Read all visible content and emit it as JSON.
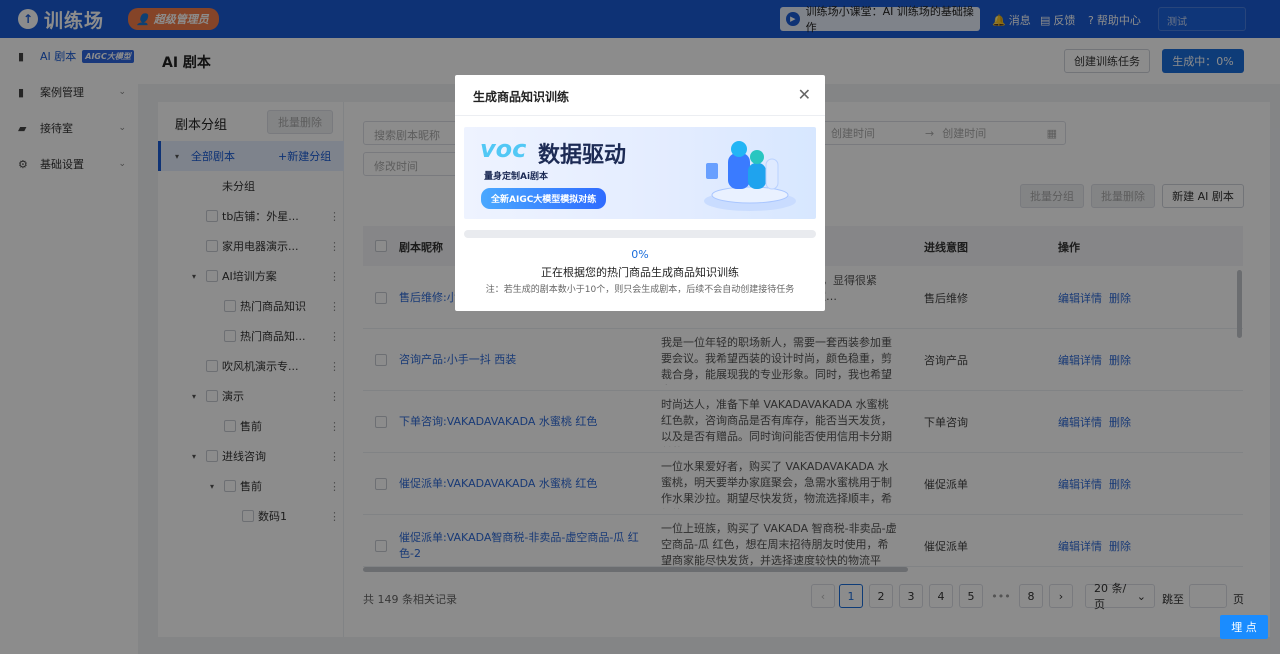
{
  "topbar": {
    "logo": "训练场",
    "admin_badge": "超级管理员",
    "class_text": "训练场小课堂：AI 训练场的基础操作",
    "messages": "消息",
    "feedback": "反馈",
    "help": "帮助中心",
    "search_placeholder": "测试"
  },
  "sidebar": {
    "items": [
      {
        "label": "AI 剧本",
        "tag": "AIGC大模型"
      },
      {
        "label": "案例管理"
      },
      {
        "label": "接待室"
      },
      {
        "label": "基础设置"
      }
    ]
  },
  "header": {
    "title": "AI 剧本",
    "create_task": "创建训练任务",
    "generating": "生成中：0%"
  },
  "groups": {
    "title": "剧本分组",
    "batch_delete": "批量删除",
    "all": "全部剧本",
    "new_group": "+新建分组",
    "tree": [
      {
        "label": "未分组"
      },
      {
        "label": "tb店铺：外星..."
      },
      {
        "label": "家用电器演示..."
      },
      {
        "label": "AI培训方案"
      },
      {
        "label": "热门商品知识"
      },
      {
        "label": "热门商品知..."
      },
      {
        "label": "吹风机演示专..."
      },
      {
        "label": "演示"
      },
      {
        "label": "售前"
      },
      {
        "label": "进线咨询"
      },
      {
        "label": "售前"
      },
      {
        "label": "数码1"
      }
    ]
  },
  "filters": {
    "search_placeholder": "搜索剧本昵称",
    "start_time": "创建时间",
    "end_time": "创建时间",
    "modify_time": "修改时间"
  },
  "toolbar": {
    "batch_group": "批量分组",
    "batch_delete": "批量删除",
    "new_script": "新建 AI 剧本"
  },
  "table": {
    "headers": {
      "name": "剧本昵称",
      "intent": "进线意图",
      "action": "操作"
    },
    "edit": "编辑详情",
    "delete": "删除",
    "rows": [
      {
        "name": "售后维修:小",
        "desc": "职场人士，购买 …尺寸不太合 适，显得很紧绷，影响了整体的形象。希望商家…",
        "intent": "售后维修"
      },
      {
        "name": "咨询产品:小手一抖 西装",
        "desc": "我是一位年轻的职场新人，需要一套西装参加重要会议。我希望西装的设计时尚，颜色稳重，剪裁合身，能展现我的专业形象。同时，我也希望它具…",
        "intent": "咨询产品"
      },
      {
        "name": "下单咨询:VAKADAVAKADA 水蜜桃 红色",
        "desc": "时尚达人，准备下单 VAKADAVAKADA 水蜜桃红色款，咨询商品是否有库存，能否当天发货，以及是否有赠品。同时询问能否使用信用卡分期付款。",
        "intent": "下单咨询"
      },
      {
        "name": "催促派单:VAKADAVAKADA 水蜜桃 红色",
        "desc": "一位水果爱好者，购买了 VAKADAVAKADA 水蜜桃，明天要举办家庭聚会，急需水蜜桃用于制作水果沙拉。期望尽快发货，物流选择顺丰，希望能…",
        "intent": "催促派单"
      },
      {
        "name": "催促派单:VAKADA智商税-非卖品-虚空商品-瓜 红色-2",
        "desc": "一位上班族，购买了 VAKADA 智商税-非卖品-虚空商品-瓜 红色，想在周末招待朋友时使用，希望商家能尽快发货，并选择速度较快的物流平台，最…",
        "intent": "催促派单"
      }
    ]
  },
  "pagination": {
    "total": "共 149 条相关记录",
    "pages": [
      "1",
      "2",
      "3",
      "4",
      "5",
      "•••",
      "8"
    ],
    "prev": "‹",
    "next": "›",
    "page_size": "20 条/页",
    "goto": "跳至",
    "page_unit": "页"
  },
  "modal": {
    "title": "生成商品知识训练",
    "banner_voc": "voc",
    "banner_title": "数据驱动",
    "banner_sub": "量身定制Ai剧本",
    "banner_pill": "全新AIGC大模型模拟对练",
    "progress": 0,
    "percent": "0%",
    "message": "正在根据您的热门商品生成商品知识训练",
    "note": "注：若生成的剧本数小于10个，则只会生成剧本，后续不会自动创建接待任务"
  },
  "float_button": "埋 点",
  "colors": {
    "brand": "#1a5cd6",
    "link": "#2f6bd8",
    "badge": "#f27d4a"
  }
}
